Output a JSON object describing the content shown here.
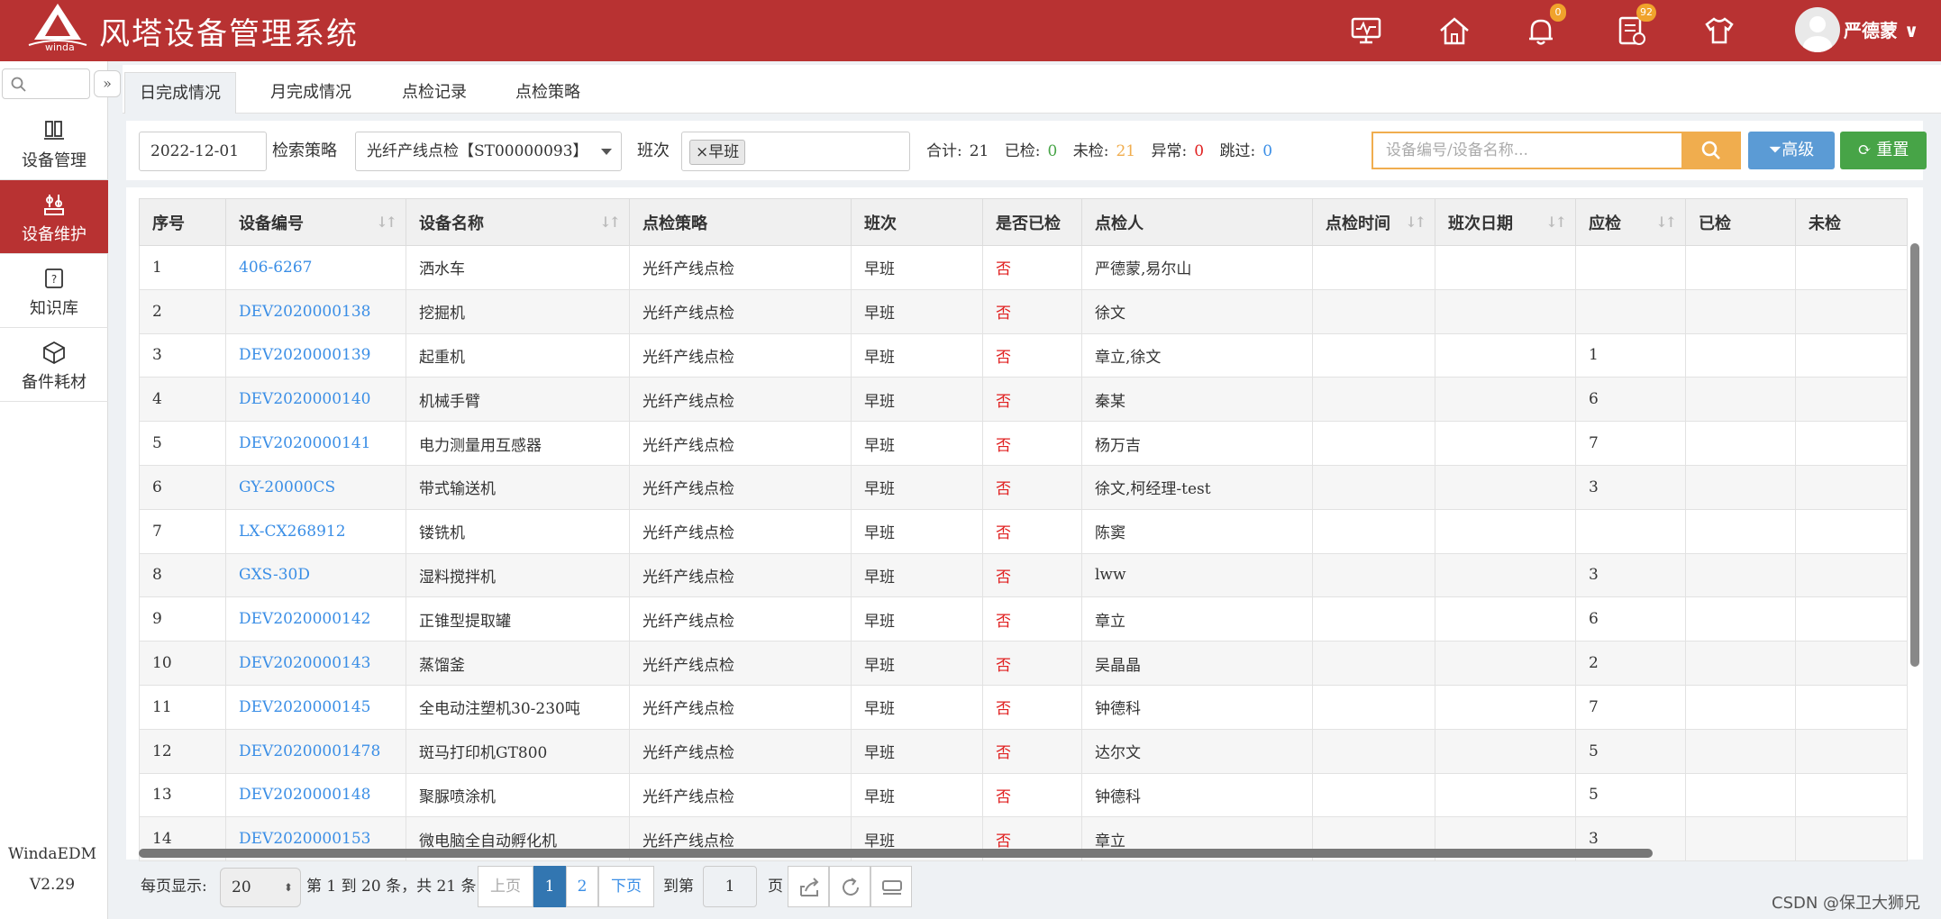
{
  "header": {
    "logo_text": "winda",
    "title": "风塔设备管理系统",
    "icons": [
      {
        "name": "monitor-icon",
        "badge": ""
      },
      {
        "name": "home-icon",
        "badge": ""
      },
      {
        "name": "bell-icon",
        "badge": "0"
      },
      {
        "name": "task-list-icon",
        "badge": "92"
      },
      {
        "name": "shirt-icon",
        "badge": ""
      }
    ],
    "user_name": "严德蒙 ∨",
    "bg_color": "#b83232"
  },
  "sidebar": {
    "items": [
      {
        "label": "设备管理",
        "icon": "equipment-icon",
        "active": false
      },
      {
        "label": "设备维护",
        "icon": "maintenance-icon",
        "active": true
      },
      {
        "label": "知识库",
        "icon": "knowledge-icon",
        "active": false
      },
      {
        "label": "备件耗材",
        "icon": "cube-icon",
        "active": false
      }
    ],
    "app_name": "WindaEDM",
    "version": "V2.29"
  },
  "tabs": [
    "日完成情况",
    "月完成情况",
    "点检记录",
    "点检策略"
  ],
  "filters": {
    "date": "2022-12-01",
    "strategy_label": "检索策略",
    "strategy_value": "光纤产线点检【ST00000093】",
    "shift_label": "班次",
    "shift_tag": "×早班",
    "stats": [
      {
        "label": "合计:",
        "value": "21",
        "color": "#333333"
      },
      {
        "label": "已检:",
        "value": "0",
        "color": "#47a447"
      },
      {
        "label": "未检:",
        "value": "21",
        "color": "#f0ad4e"
      },
      {
        "label": "异常:",
        "value": "0",
        "color": "#e02020"
      },
      {
        "label": "跳过:",
        "value": "0",
        "color": "#3a8ee6"
      }
    ],
    "search_placeholder": "设备编号/设备名称...",
    "advanced_label": "高级",
    "reset_label": "重置"
  },
  "table": {
    "columns": [
      "序号",
      "设备编号",
      "设备名称",
      "点检策略",
      "班次",
      "是否已检",
      "点检人",
      "点检时间",
      "班次日期",
      "应检",
      "已检",
      "未检"
    ],
    "rows": [
      [
        "1",
        "406-6267",
        "洒水车",
        "光纤产线点检",
        "早班",
        "否",
        "严德蒙,易尔山",
        "",
        "",
        "",
        "",
        ""
      ],
      [
        "2",
        "DEV2020000138",
        "挖掘机",
        "光纤产线点检",
        "早班",
        "否",
        "徐文",
        "",
        "",
        "",
        "",
        ""
      ],
      [
        "3",
        "DEV2020000139",
        "起重机",
        "光纤产线点检",
        "早班",
        "否",
        "章立,徐文",
        "",
        "",
        "1",
        "",
        ""
      ],
      [
        "4",
        "DEV2020000140",
        "机械手臂",
        "光纤产线点检",
        "早班",
        "否",
        "秦某",
        "",
        "",
        "6",
        "",
        ""
      ],
      [
        "5",
        "DEV2020000141",
        "电力测量用互感器",
        "光纤产线点检",
        "早班",
        "否",
        "杨万吉",
        "",
        "",
        "7",
        "",
        ""
      ],
      [
        "6",
        "GY-20000CS",
        "带式输送机",
        "光纤产线点检",
        "早班",
        "否",
        "徐文,柯经理-test",
        "",
        "",
        "3",
        "",
        ""
      ],
      [
        "7",
        "LX-CX268912",
        "镂铣机",
        "光纤产线点检",
        "早班",
        "否",
        "陈窦",
        "",
        "",
        "",
        "",
        ""
      ],
      [
        "8",
        "GXS-30D",
        "湿料搅拌机",
        "光纤产线点检",
        "早班",
        "否",
        "lww",
        "",
        "",
        "3",
        "",
        ""
      ],
      [
        "9",
        "DEV2020000142",
        "正锥型提取罐",
        "光纤产线点检",
        "早班",
        "否",
        "章立",
        "",
        "",
        "6",
        "",
        ""
      ],
      [
        "10",
        "DEV2020000143",
        "蒸馏釜",
        "光纤产线点检",
        "早班",
        "否",
        "吴晶晶",
        "",
        "",
        "2",
        "",
        ""
      ],
      [
        "11",
        "DEV2020000145",
        "全电动注塑机30-230吨",
        "光纤产线点检",
        "早班",
        "否",
        "钟德科",
        "",
        "",
        "7",
        "",
        ""
      ],
      [
        "12",
        "DEV20200001478",
        "斑马打印机GT800",
        "光纤产线点检",
        "早班",
        "否",
        "达尔文",
        "",
        "",
        "5",
        "",
        ""
      ],
      [
        "13",
        "DEV2020000148",
        "聚脲喷涂机",
        "光纤产线点检",
        "早班",
        "否",
        "钟德科",
        "",
        "",
        "5",
        "",
        ""
      ],
      [
        "14",
        "DEV2020000153",
        "微电脑全自动孵化机",
        "光纤产线点检",
        "早班",
        "否",
        "章立",
        "",
        "",
        "3",
        "",
        ""
      ]
    ]
  },
  "pagination": {
    "per_page_label": "每页显示:",
    "per_page": "20",
    "summary": "第 1 到 20 条，共 21 条",
    "prev": "上页",
    "pages": [
      "1",
      "2"
    ],
    "next": "下页",
    "goto_label": "到第",
    "goto_value": "1",
    "page_suffix": "页"
  },
  "watermark": "CSDN @保卫大狮兄"
}
